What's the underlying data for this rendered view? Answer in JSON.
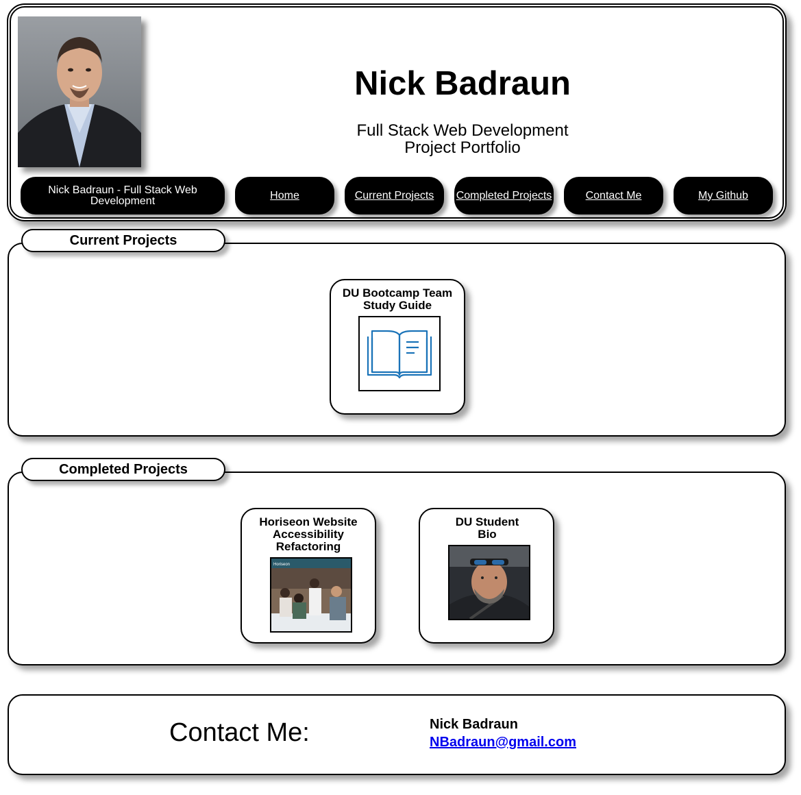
{
  "header": {
    "name": "Nick Badraun",
    "subtitle_line1": "Full Stack Web Development",
    "subtitle_line2": "Project Portfolio"
  },
  "nav": {
    "brand": "Nick Badraun - Full Stack Web Development",
    "items": [
      {
        "label": "Home"
      },
      {
        "label": "Current Projects"
      },
      {
        "label": "Completed Projects"
      },
      {
        "label": "Contact Me"
      },
      {
        "label": "My Github"
      }
    ]
  },
  "current_projects": {
    "heading": "Current Projects",
    "cards": [
      {
        "title": "DU Bootcamp Team Study Guide",
        "icon": "open-book-icon"
      }
    ]
  },
  "completed_projects": {
    "heading": "Completed Projects",
    "cards": [
      {
        "title": "Horiseon Website Accessibility Refactoring",
        "thumb_brand": "Horiseon"
      },
      {
        "title": "DU Student Bio"
      }
    ]
  },
  "contact": {
    "label": "Contact Me:",
    "name": "Nick Badraun",
    "email": "NBadraun@gmail.com"
  },
  "colors": {
    "nav_bg": "#000000",
    "link": "#0000ee",
    "book_icon": "#1a73b8"
  }
}
